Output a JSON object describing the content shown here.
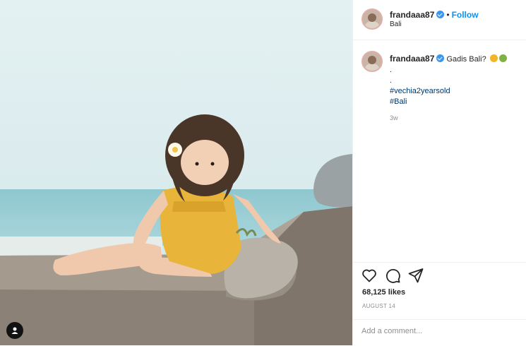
{
  "post": {
    "username": "frandaaa87",
    "follow_label": "Follow",
    "separator": "•",
    "location": "Bali",
    "caption": {
      "text": "Gadis Bali?",
      "emoji": [
        "star-struck-emoji",
        "smiling-face-emoji"
      ],
      "lines": [
        ".",
        "."
      ],
      "hashtags": [
        "#vechia2yearsold",
        "#Bali"
      ],
      "time": "3w"
    },
    "likes": "68,125 likes",
    "date": "AUGUST 14",
    "comment_placeholder": "Add a comment...",
    "colors": {
      "link": "#0095f6",
      "hashtag": "#00376b",
      "verified": "#3897f0",
      "sky": "#dfeef1",
      "dress": "#e8b53a"
    },
    "icons": [
      "heart-icon",
      "comment-icon",
      "share-icon",
      "user-tag-icon",
      "verified-badge-icon"
    ]
  }
}
